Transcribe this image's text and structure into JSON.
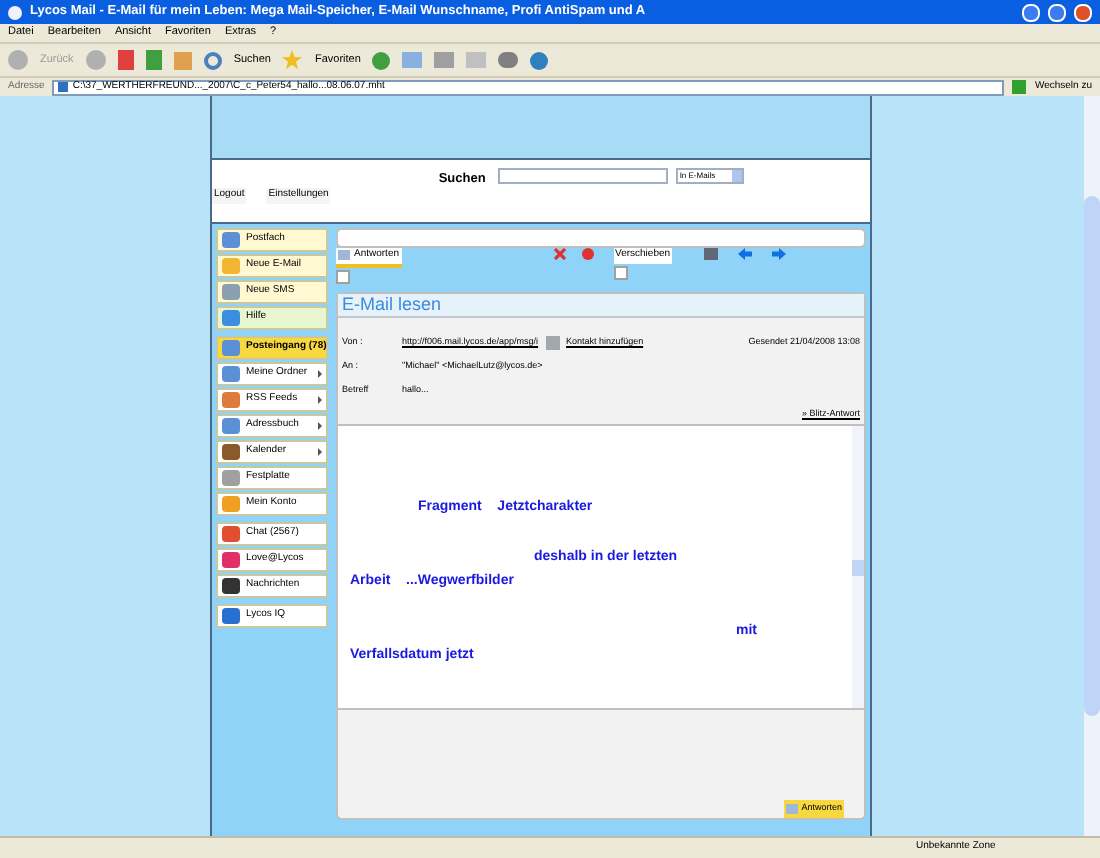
{
  "window": {
    "title": "Lycos Mail - E-Mail für mein Leben: Mega Mail-Speicher, E-Mail Wunschname, Profi AntiSpam und A"
  },
  "menu": [
    "Datei",
    "Bearbeiten",
    "Ansicht",
    "Favoriten",
    "Extras",
    "?"
  ],
  "toolbar": {
    "back": "Zurück",
    "search": "Suchen",
    "favorites": "Favoriten"
  },
  "address": {
    "label": "Adresse",
    "value": "C:\\37_WERTHERFREUND..._2007\\C_c_Peter54_hallo...08.06.07.mht",
    "go": "Wechseln zu"
  },
  "header": {
    "logout": "Logout",
    "settings": "Einstellungen",
    "search_label": "Suchen",
    "search_scope": "In E-Mails"
  },
  "sidebar": {
    "groups": [
      [
        {
          "label": "Postfach",
          "selected": false
        },
        {
          "label": "Neue E-Mail",
          "selected": false
        },
        {
          "label": "Neue SMS",
          "selected": false
        },
        {
          "label": "Hilfe",
          "selected": false
        }
      ],
      [
        {
          "label": "Posteingang (78)",
          "selected": true,
          "submenu": false
        },
        {
          "label": "Meine Ordner",
          "selected": false,
          "submenu": true
        },
        {
          "label": "RSS Feeds",
          "selected": false,
          "submenu": true
        },
        {
          "label": "Adressbuch",
          "selected": false,
          "submenu": true
        },
        {
          "label": "Kalender",
          "selected": false,
          "submenu": true
        },
        {
          "label": "Festplatte",
          "selected": false,
          "submenu": false
        },
        {
          "label": "Mein Konto",
          "selected": false,
          "submenu": false
        }
      ],
      [
        {
          "label": "Chat (2567)",
          "selected": false
        },
        {
          "label": "Love@Lycos",
          "selected": false
        },
        {
          "label": "Nachrichten",
          "selected": false
        }
      ],
      [
        {
          "label": "Lycos IQ",
          "selected": false
        }
      ]
    ]
  },
  "mail_toolbar": {
    "reply": "Antworten",
    "move": "Verschieben"
  },
  "mail": {
    "title": "E-Mail lesen",
    "from_label": "Von :",
    "from": "http://f006.mail.lycos.de/app/msg/i",
    "add_contact": "Kontakt hinzufügen",
    "sent": "Gesendet 21/04/2008 13:08",
    "to_label": "An :",
    "to": "\"Michael\" <MichaelLutz@lycos.de>",
    "subject_label": "Betreff",
    "subject": "hallo...",
    "quick_reply": "» Blitz-Antwort",
    "body": [
      "Fragment    Jetztcharakter",
      "deshalb in der letzten",
      "Arbeit    ...Wegwerfbilder",
      "mit",
      "Verfallsdatum jetzt"
    ],
    "bottom_reply": "Antworten"
  },
  "status_bar": {
    "zone": "Unbekannte Zone"
  }
}
